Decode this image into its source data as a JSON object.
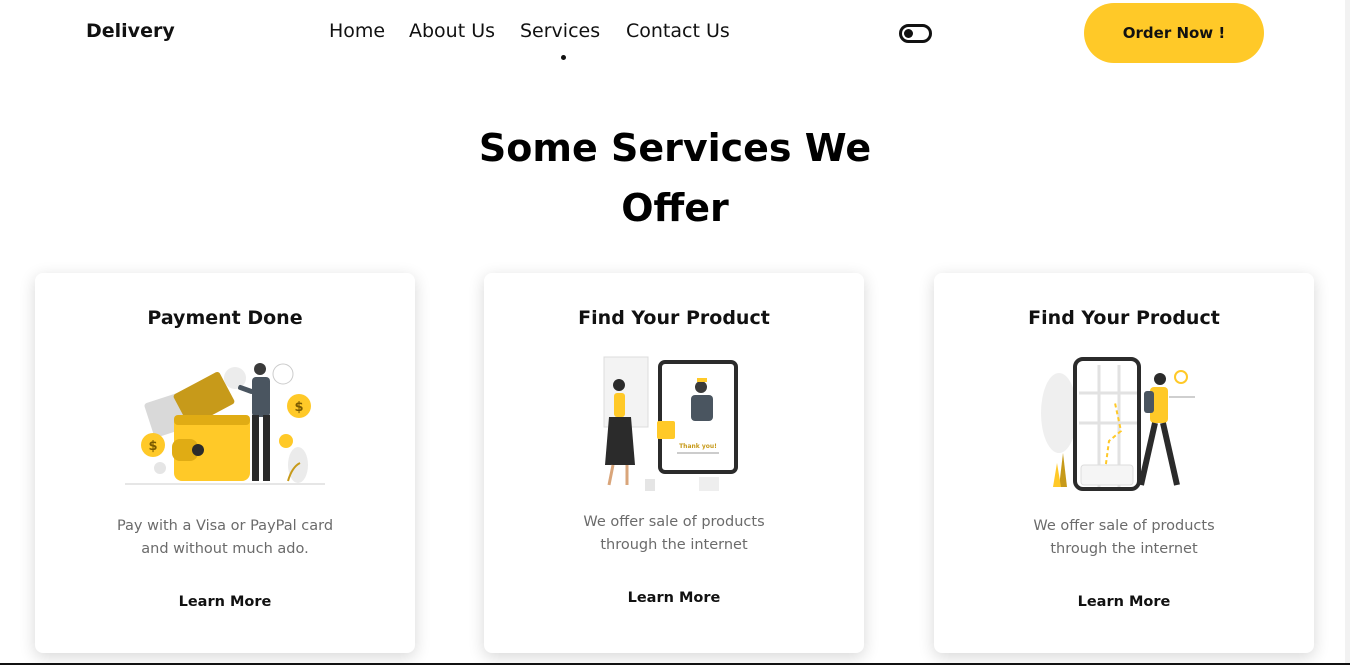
{
  "nav": {
    "brand": "Delivery",
    "links": [
      "Home",
      "About Us",
      "Services",
      "Contact Us"
    ],
    "active_index": 2,
    "order_button": "Order Now !"
  },
  "section": {
    "title_line1": "Some Services We",
    "title_line2": "Offer"
  },
  "cards": [
    {
      "title": "Payment Done",
      "desc_line1": "Pay with a Visa or PayPal card",
      "desc_line2": "and without much ado.",
      "link": "Learn More"
    },
    {
      "title": "Find Your Product",
      "desc_line1": "We offer sale of products",
      "desc_line2": "through the internet",
      "link": "Learn More",
      "illustration_text": "Thank you!"
    },
    {
      "title": "Find Your Product",
      "desc_line1": "We offer sale of products",
      "desc_line2": "through the internet",
      "link": "Learn More"
    }
  ],
  "colors": {
    "accent": "#ffc928",
    "text": "#111111",
    "muted": "#6b6b6b",
    "background": "#ffffff"
  },
  "icons": [
    "theme-toggle-icon",
    "wallet-payment-illustration",
    "online-shopping-illustration",
    "map-navigation-illustration"
  ]
}
